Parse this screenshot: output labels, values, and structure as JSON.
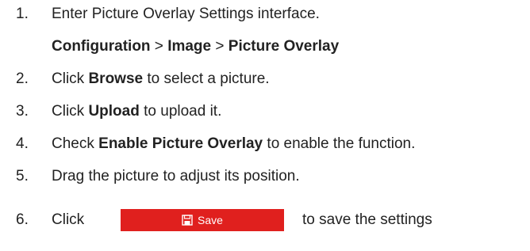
{
  "steps": [
    {
      "number": "1.",
      "text": "Enter Picture Overlay Settings interface."
    },
    {
      "number": "2.",
      "pre": "Click ",
      "bold": "Browse",
      "post": " to select a picture."
    },
    {
      "number": "3.",
      "pre": "Click ",
      "bold": "Upload",
      "post": " to upload it."
    },
    {
      "number": "4.",
      "pre": "Check ",
      "bold": "Enable Picture Overlay",
      "post": " to enable the function."
    },
    {
      "number": "5.",
      "text": "Drag the picture to adjust its position."
    },
    {
      "number": "6.",
      "pre": "Click",
      "post": "to save the settings"
    }
  ],
  "path": {
    "part1": "Configuration",
    "sep1": " > ",
    "part2": "Image",
    "sep2": " > ",
    "part3": "Picture Overlay"
  },
  "save_button": {
    "label": "Save",
    "icon": "save-icon",
    "color": "#e0201e"
  }
}
